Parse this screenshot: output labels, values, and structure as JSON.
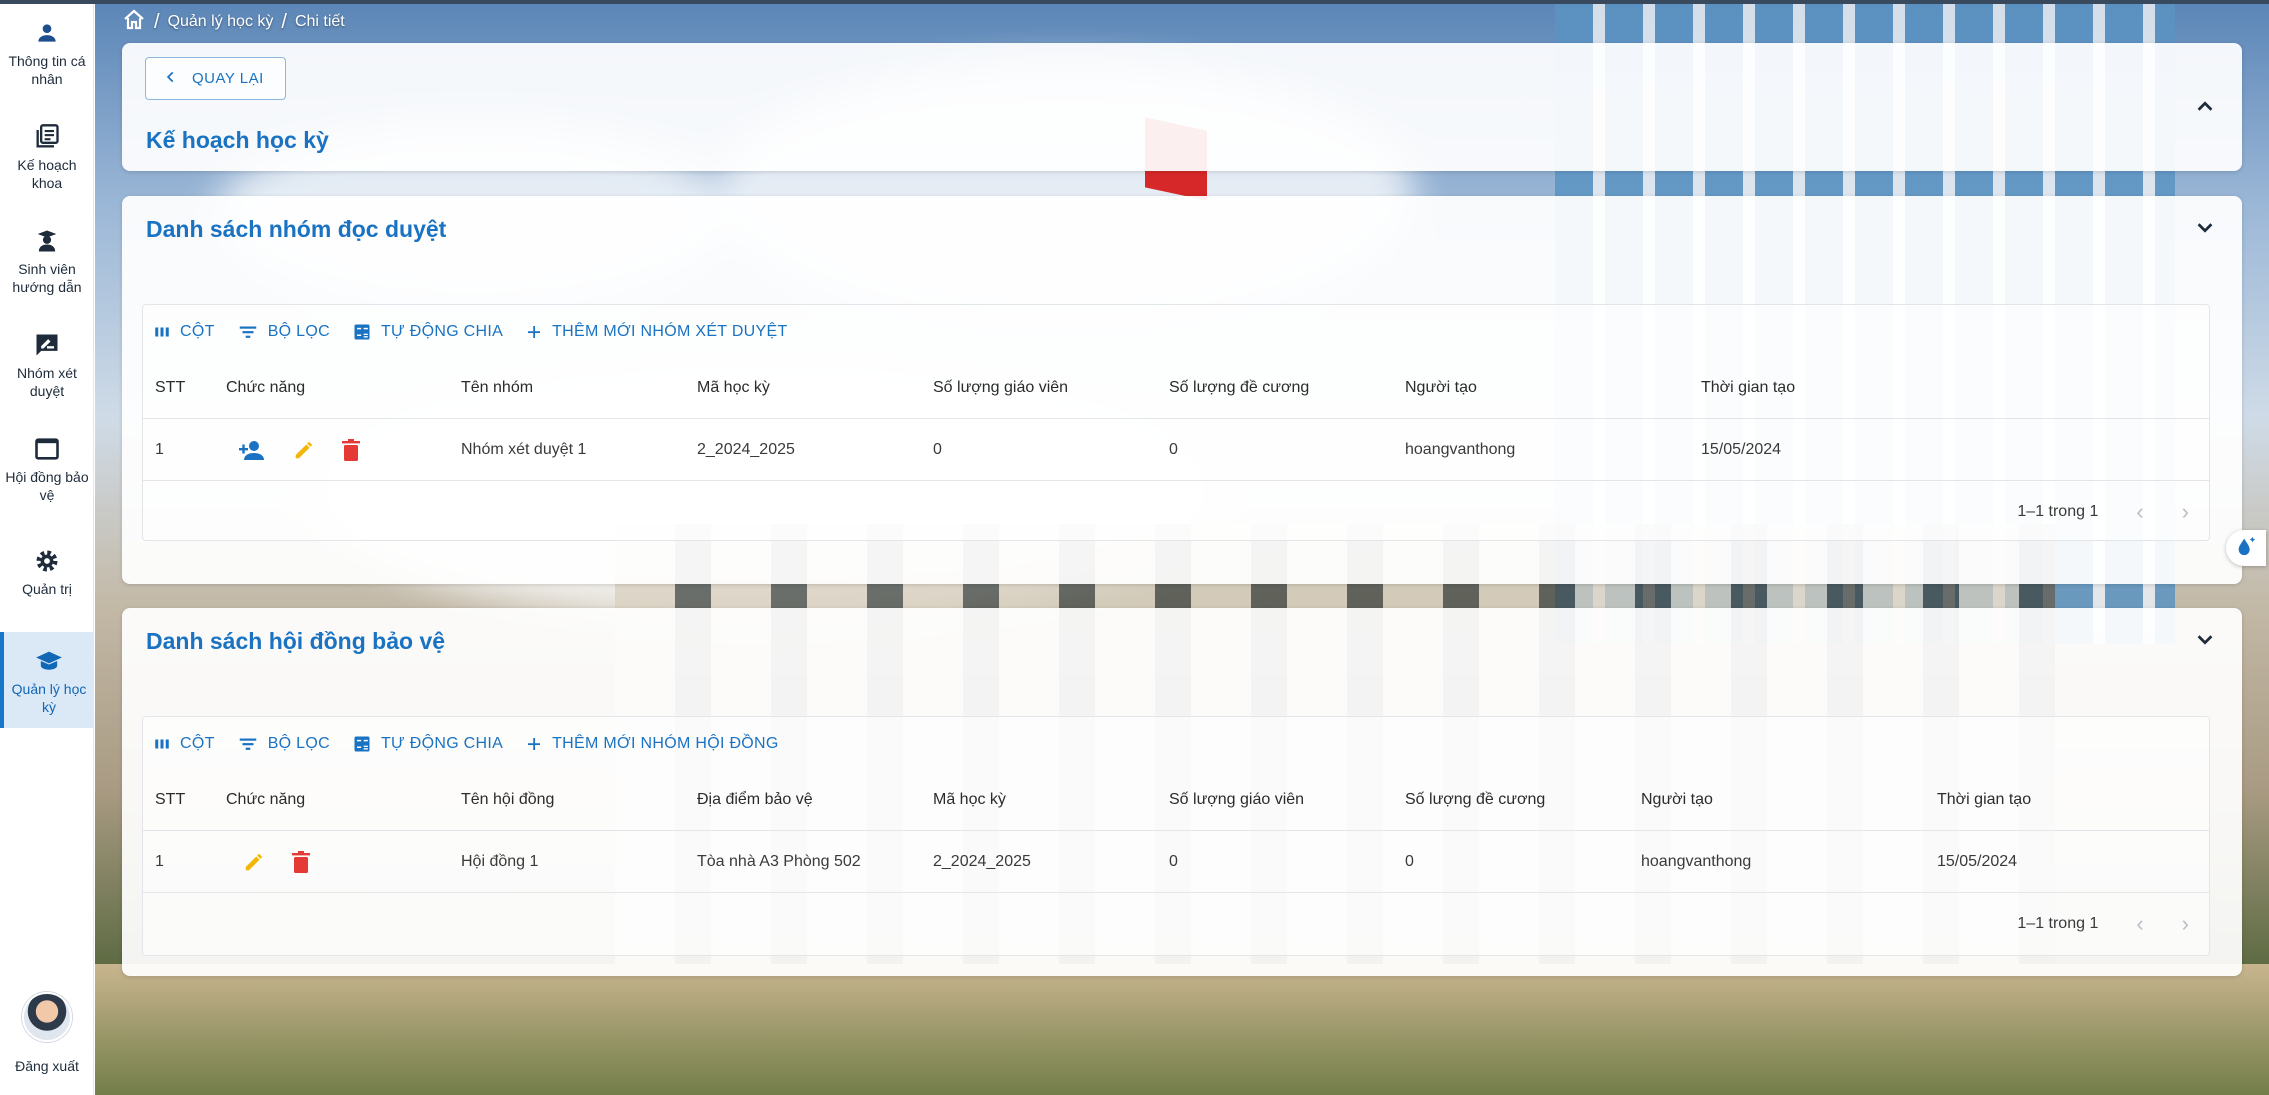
{
  "sidebar": {
    "items": [
      {
        "label": "Thông tin cá nhân"
      },
      {
        "label": "Kế hoạch khoa"
      },
      {
        "label": "Sinh viên hướng dẫn"
      },
      {
        "label": "Nhóm xét duyệt"
      },
      {
        "label": "Hội đồng bảo vệ"
      },
      {
        "label": "Quản trị"
      },
      {
        "label": "Quản lý học kỳ"
      }
    ],
    "logout_label": "Đăng xuất"
  },
  "breadcrumb": {
    "items": [
      "Quản lý học kỳ",
      "Chi tiết"
    ],
    "separator": "/"
  },
  "plan_card": {
    "back_label": "QUAY LẠI",
    "title": "Kế hoạch học kỳ"
  },
  "toolbar": {
    "columns": "CỘT",
    "filter": "BỘ LỌC",
    "auto_split": "TỰ ĐỘNG CHIA"
  },
  "review_groups": {
    "title": "Danh sách nhóm đọc duyệt",
    "add_label": "THÊM MỚI NHÓM XÉT DUYỆT",
    "columns": [
      "STT",
      "Chức năng",
      "Tên nhóm",
      "Mã học kỳ",
      "Số lượng giáo viên",
      "Số lượng đề cương",
      "Người tạo",
      "Thời gian tạo"
    ],
    "rows": [
      {
        "stt": "1",
        "name": "Nhóm xét duyệt 1",
        "semester": "2_2024_2025",
        "teachers": "0",
        "outlines": "0",
        "creator": "hoangvanthong",
        "created": "15/05/2024"
      }
    ],
    "pagination": "1–1 trong 1"
  },
  "councils": {
    "title": "Danh sách hội đồng bảo vệ",
    "add_label": "THÊM MỚI NHÓM HỘI ĐỒNG",
    "columns": [
      "STT",
      "Chức năng",
      "Tên hội đồng",
      "Địa điểm bảo vệ",
      "Mã học kỳ",
      "Số lượng giáo viên",
      "Số lượng đề cương",
      "Người tạo",
      "Thời gian tạo"
    ],
    "rows": [
      {
        "stt": "1",
        "name": "Hội đồng 1",
        "location": "Tòa nhà A3 Phòng 502",
        "semester": "2_2024_2025",
        "teachers": "0",
        "outlines": "0",
        "creator": "hoangvanthong",
        "created": "15/05/2024"
      }
    ],
    "pagination": "1–1 trong 1"
  },
  "colors": {
    "primary": "#1a73c2",
    "edit": "#f2b705",
    "delete": "#e53935",
    "active_bg": "#dbe9f7"
  }
}
